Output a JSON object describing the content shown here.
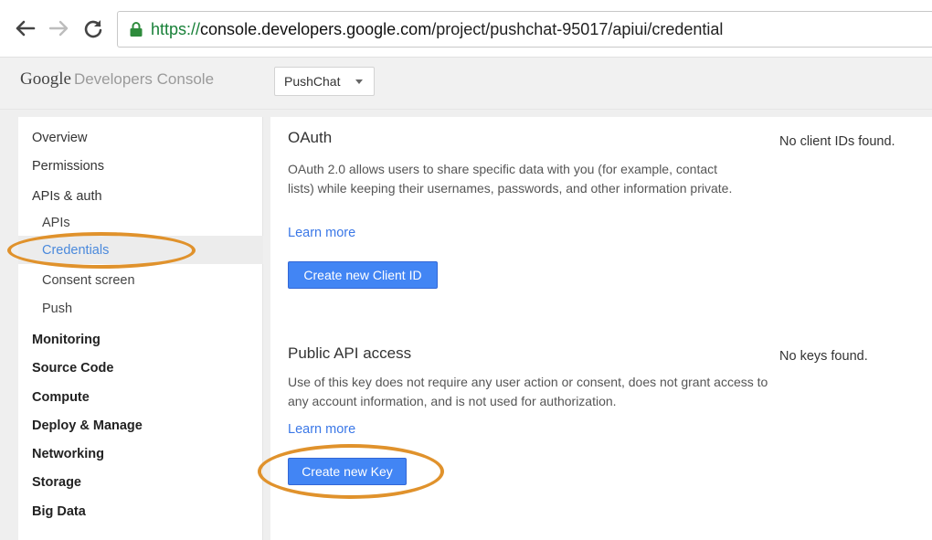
{
  "browser": {
    "url_scheme": "https://",
    "url_host": "console.developers.google.com",
    "url_path": "/project/pushchat-95017/apiui/credential"
  },
  "header": {
    "brand_google": "Google",
    "brand_product": "Developers Console",
    "project_selected": "PushChat"
  },
  "sidebar": {
    "items": [
      {
        "label": "Overview"
      },
      {
        "label": "Permissions"
      },
      {
        "label": "APIs & auth"
      },
      {
        "label": "APIs"
      },
      {
        "label": "Credentials"
      },
      {
        "label": "Consent screen"
      },
      {
        "label": "Push"
      },
      {
        "label": "Monitoring"
      },
      {
        "label": "Source Code"
      },
      {
        "label": "Compute"
      },
      {
        "label": "Deploy & Manage"
      },
      {
        "label": "Networking"
      },
      {
        "label": "Storage"
      },
      {
        "label": "Big Data"
      }
    ],
    "active_item": "Credentials"
  },
  "oauth": {
    "title": "OAuth",
    "description": "OAuth 2.0 allows users to share specific data with you (for example, contact lists) while keeping their usernames, passwords, and other information private.",
    "learn_more": "Learn more",
    "button_label": "Create new Client ID",
    "status": "No client IDs found."
  },
  "public_api": {
    "title": "Public API access",
    "description": "Use of this key does not require any user action or consent, does not grant access to any account information, and is not used for authorization.",
    "learn_more": "Learn more",
    "button_label": "Create new Key",
    "status": "No keys found."
  },
  "colors": {
    "accent_blue": "#4285f4",
    "link_blue": "#3b78e7",
    "annotation_orange": "#e0922c"
  }
}
